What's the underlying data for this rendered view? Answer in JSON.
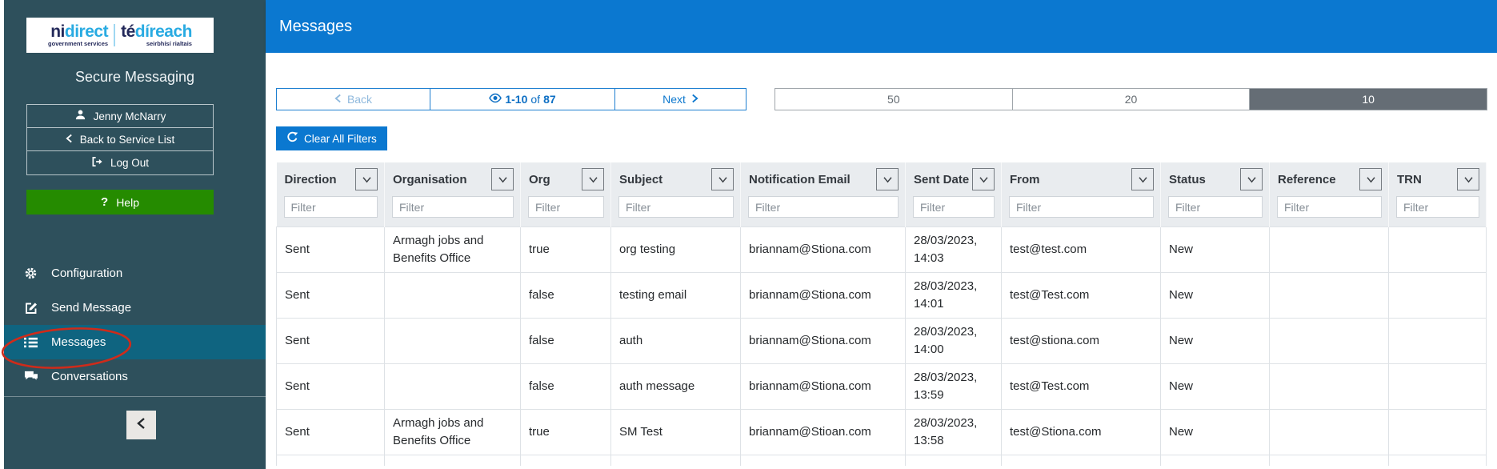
{
  "sidebar": {
    "logo": {
      "brand_en_prefix": "ni",
      "brand_en_rest": "direct",
      "tagline_en": "government services",
      "brand_ga_prefix": "té",
      "brand_ga_rest": "díreach",
      "tagline_ga": "seirbhísí rialtais"
    },
    "app_title": "Secure Messaging",
    "user_button": {
      "label": "Jenny McNarry",
      "icon": "user-icon"
    },
    "back_button": {
      "label": "Back to Service List",
      "icon": "chevron-left-icon"
    },
    "logout_button": {
      "label": "Log Out",
      "icon": "logout-icon"
    },
    "help_button": {
      "label": "Help",
      "icon": "question-mark-icon"
    },
    "nav": [
      {
        "label": "Configuration",
        "icon": "gear-icon",
        "active": false
      },
      {
        "label": "Send Message",
        "icon": "compose-icon",
        "active": false
      },
      {
        "label": "Messages",
        "icon": "list-icon",
        "active": true,
        "annotated": "red-ellipse"
      },
      {
        "label": "Conversations",
        "icon": "chat-icon",
        "active": false
      }
    ],
    "collapse_button": {
      "icon": "chevron-left-icon"
    }
  },
  "header": {
    "title": "Messages"
  },
  "pagination": {
    "back_label": "Back",
    "range_label": "1-10",
    "of_label": "of",
    "total_label": "87",
    "next_label": "Next",
    "eye_icon": "eye-icon"
  },
  "page_size": {
    "options": [
      "50",
      "20",
      "10"
    ],
    "selected": "10"
  },
  "toolbar": {
    "clear_filters_label": "Clear All Filters",
    "icon": "refresh-icon"
  },
  "table": {
    "filter_placeholder": "Filter",
    "columns": [
      "Direction",
      "Organisation",
      "Org",
      "Subject",
      "Notification Email",
      "Sent Date",
      "From",
      "Status",
      "Reference",
      "TRN"
    ],
    "rows": [
      [
        "Sent",
        "Armagh jobs and Benefits Office",
        "true",
        "org testing",
        "briannam@Stiona.com",
        "28/03/2023, 14:03",
        "test@test.com",
        "New",
        "",
        ""
      ],
      [
        "Sent",
        "",
        "false",
        "testing email",
        "briannam@Stiona.com",
        "28/03/2023, 14:01",
        "test@Test.com",
        "New",
        "",
        ""
      ],
      [
        "Sent",
        "",
        "false",
        "auth",
        "briannam@Stiona.com",
        "28/03/2023, 14:00",
        "test@stiona.com",
        "New",
        "",
        ""
      ],
      [
        "Sent",
        "",
        "false",
        "auth message",
        "briannam@Stiona.com",
        "28/03/2023, 13:59",
        "test@Test.com",
        "New",
        "",
        ""
      ],
      [
        "Sent",
        "Armagh jobs and Benefits Office",
        "true",
        "SM Test",
        "briannam@Stioan.com",
        "28/03/2023, 13:58",
        "test@Stiona.com",
        "New",
        "",
        ""
      ]
    ]
  },
  "colors": {
    "sidebar_bg": "#2e505c",
    "sidebar_active_bg": "#0f6480",
    "header_blue": "#0b78d0",
    "help_green": "#258b00",
    "selected_page_size_bg": "#656d75",
    "annotation_red": "#cf2b1a",
    "brand_navy": "#23295a",
    "brand_blue": "#29abe2"
  }
}
